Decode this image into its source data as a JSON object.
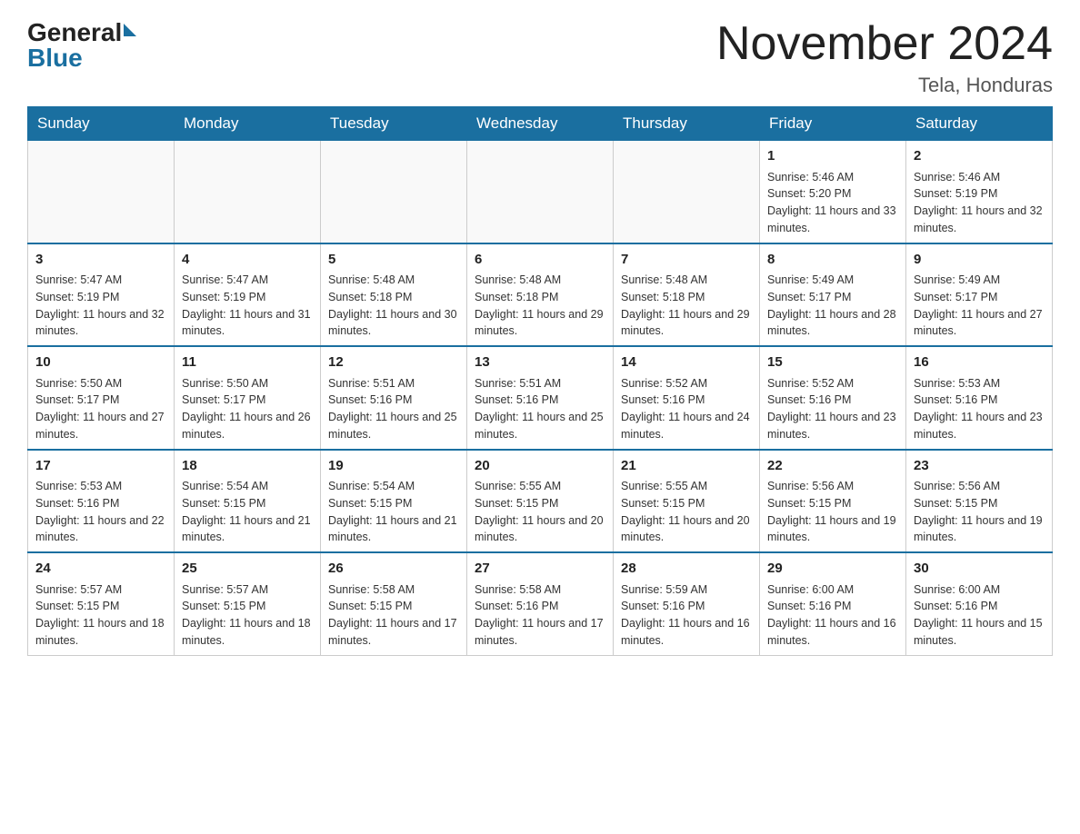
{
  "logo": {
    "general": "General",
    "blue": "Blue"
  },
  "title": "November 2024",
  "subtitle": "Tela, Honduras",
  "weekdays": [
    "Sunday",
    "Monday",
    "Tuesday",
    "Wednesday",
    "Thursday",
    "Friday",
    "Saturday"
  ],
  "weeks": [
    [
      {
        "day": "",
        "sunrise": "",
        "sunset": "",
        "daylight": ""
      },
      {
        "day": "",
        "sunrise": "",
        "sunset": "",
        "daylight": ""
      },
      {
        "day": "",
        "sunrise": "",
        "sunset": "",
        "daylight": ""
      },
      {
        "day": "",
        "sunrise": "",
        "sunset": "",
        "daylight": ""
      },
      {
        "day": "",
        "sunrise": "",
        "sunset": "",
        "daylight": ""
      },
      {
        "day": "1",
        "sunrise": "Sunrise: 5:46 AM",
        "sunset": "Sunset: 5:20 PM",
        "daylight": "Daylight: 11 hours and 33 minutes."
      },
      {
        "day": "2",
        "sunrise": "Sunrise: 5:46 AM",
        "sunset": "Sunset: 5:19 PM",
        "daylight": "Daylight: 11 hours and 32 minutes."
      }
    ],
    [
      {
        "day": "3",
        "sunrise": "Sunrise: 5:47 AM",
        "sunset": "Sunset: 5:19 PM",
        "daylight": "Daylight: 11 hours and 32 minutes."
      },
      {
        "day": "4",
        "sunrise": "Sunrise: 5:47 AM",
        "sunset": "Sunset: 5:19 PM",
        "daylight": "Daylight: 11 hours and 31 minutes."
      },
      {
        "day": "5",
        "sunrise": "Sunrise: 5:48 AM",
        "sunset": "Sunset: 5:18 PM",
        "daylight": "Daylight: 11 hours and 30 minutes."
      },
      {
        "day": "6",
        "sunrise": "Sunrise: 5:48 AM",
        "sunset": "Sunset: 5:18 PM",
        "daylight": "Daylight: 11 hours and 29 minutes."
      },
      {
        "day": "7",
        "sunrise": "Sunrise: 5:48 AM",
        "sunset": "Sunset: 5:18 PM",
        "daylight": "Daylight: 11 hours and 29 minutes."
      },
      {
        "day": "8",
        "sunrise": "Sunrise: 5:49 AM",
        "sunset": "Sunset: 5:17 PM",
        "daylight": "Daylight: 11 hours and 28 minutes."
      },
      {
        "day": "9",
        "sunrise": "Sunrise: 5:49 AM",
        "sunset": "Sunset: 5:17 PM",
        "daylight": "Daylight: 11 hours and 27 minutes."
      }
    ],
    [
      {
        "day": "10",
        "sunrise": "Sunrise: 5:50 AM",
        "sunset": "Sunset: 5:17 PM",
        "daylight": "Daylight: 11 hours and 27 minutes."
      },
      {
        "day": "11",
        "sunrise": "Sunrise: 5:50 AM",
        "sunset": "Sunset: 5:17 PM",
        "daylight": "Daylight: 11 hours and 26 minutes."
      },
      {
        "day": "12",
        "sunrise": "Sunrise: 5:51 AM",
        "sunset": "Sunset: 5:16 PM",
        "daylight": "Daylight: 11 hours and 25 minutes."
      },
      {
        "day": "13",
        "sunrise": "Sunrise: 5:51 AM",
        "sunset": "Sunset: 5:16 PM",
        "daylight": "Daylight: 11 hours and 25 minutes."
      },
      {
        "day": "14",
        "sunrise": "Sunrise: 5:52 AM",
        "sunset": "Sunset: 5:16 PM",
        "daylight": "Daylight: 11 hours and 24 minutes."
      },
      {
        "day": "15",
        "sunrise": "Sunrise: 5:52 AM",
        "sunset": "Sunset: 5:16 PM",
        "daylight": "Daylight: 11 hours and 23 minutes."
      },
      {
        "day": "16",
        "sunrise": "Sunrise: 5:53 AM",
        "sunset": "Sunset: 5:16 PM",
        "daylight": "Daylight: 11 hours and 23 minutes."
      }
    ],
    [
      {
        "day": "17",
        "sunrise": "Sunrise: 5:53 AM",
        "sunset": "Sunset: 5:16 PM",
        "daylight": "Daylight: 11 hours and 22 minutes."
      },
      {
        "day": "18",
        "sunrise": "Sunrise: 5:54 AM",
        "sunset": "Sunset: 5:15 PM",
        "daylight": "Daylight: 11 hours and 21 minutes."
      },
      {
        "day": "19",
        "sunrise": "Sunrise: 5:54 AM",
        "sunset": "Sunset: 5:15 PM",
        "daylight": "Daylight: 11 hours and 21 minutes."
      },
      {
        "day": "20",
        "sunrise": "Sunrise: 5:55 AM",
        "sunset": "Sunset: 5:15 PM",
        "daylight": "Daylight: 11 hours and 20 minutes."
      },
      {
        "day": "21",
        "sunrise": "Sunrise: 5:55 AM",
        "sunset": "Sunset: 5:15 PM",
        "daylight": "Daylight: 11 hours and 20 minutes."
      },
      {
        "day": "22",
        "sunrise": "Sunrise: 5:56 AM",
        "sunset": "Sunset: 5:15 PM",
        "daylight": "Daylight: 11 hours and 19 minutes."
      },
      {
        "day": "23",
        "sunrise": "Sunrise: 5:56 AM",
        "sunset": "Sunset: 5:15 PM",
        "daylight": "Daylight: 11 hours and 19 minutes."
      }
    ],
    [
      {
        "day": "24",
        "sunrise": "Sunrise: 5:57 AM",
        "sunset": "Sunset: 5:15 PM",
        "daylight": "Daylight: 11 hours and 18 minutes."
      },
      {
        "day": "25",
        "sunrise": "Sunrise: 5:57 AM",
        "sunset": "Sunset: 5:15 PM",
        "daylight": "Daylight: 11 hours and 18 minutes."
      },
      {
        "day": "26",
        "sunrise": "Sunrise: 5:58 AM",
        "sunset": "Sunset: 5:15 PM",
        "daylight": "Daylight: 11 hours and 17 minutes."
      },
      {
        "day": "27",
        "sunrise": "Sunrise: 5:58 AM",
        "sunset": "Sunset: 5:16 PM",
        "daylight": "Daylight: 11 hours and 17 minutes."
      },
      {
        "day": "28",
        "sunrise": "Sunrise: 5:59 AM",
        "sunset": "Sunset: 5:16 PM",
        "daylight": "Daylight: 11 hours and 16 minutes."
      },
      {
        "day": "29",
        "sunrise": "Sunrise: 6:00 AM",
        "sunset": "Sunset: 5:16 PM",
        "daylight": "Daylight: 11 hours and 16 minutes."
      },
      {
        "day": "30",
        "sunrise": "Sunrise: 6:00 AM",
        "sunset": "Sunset: 5:16 PM",
        "daylight": "Daylight: 11 hours and 15 minutes."
      }
    ]
  ]
}
